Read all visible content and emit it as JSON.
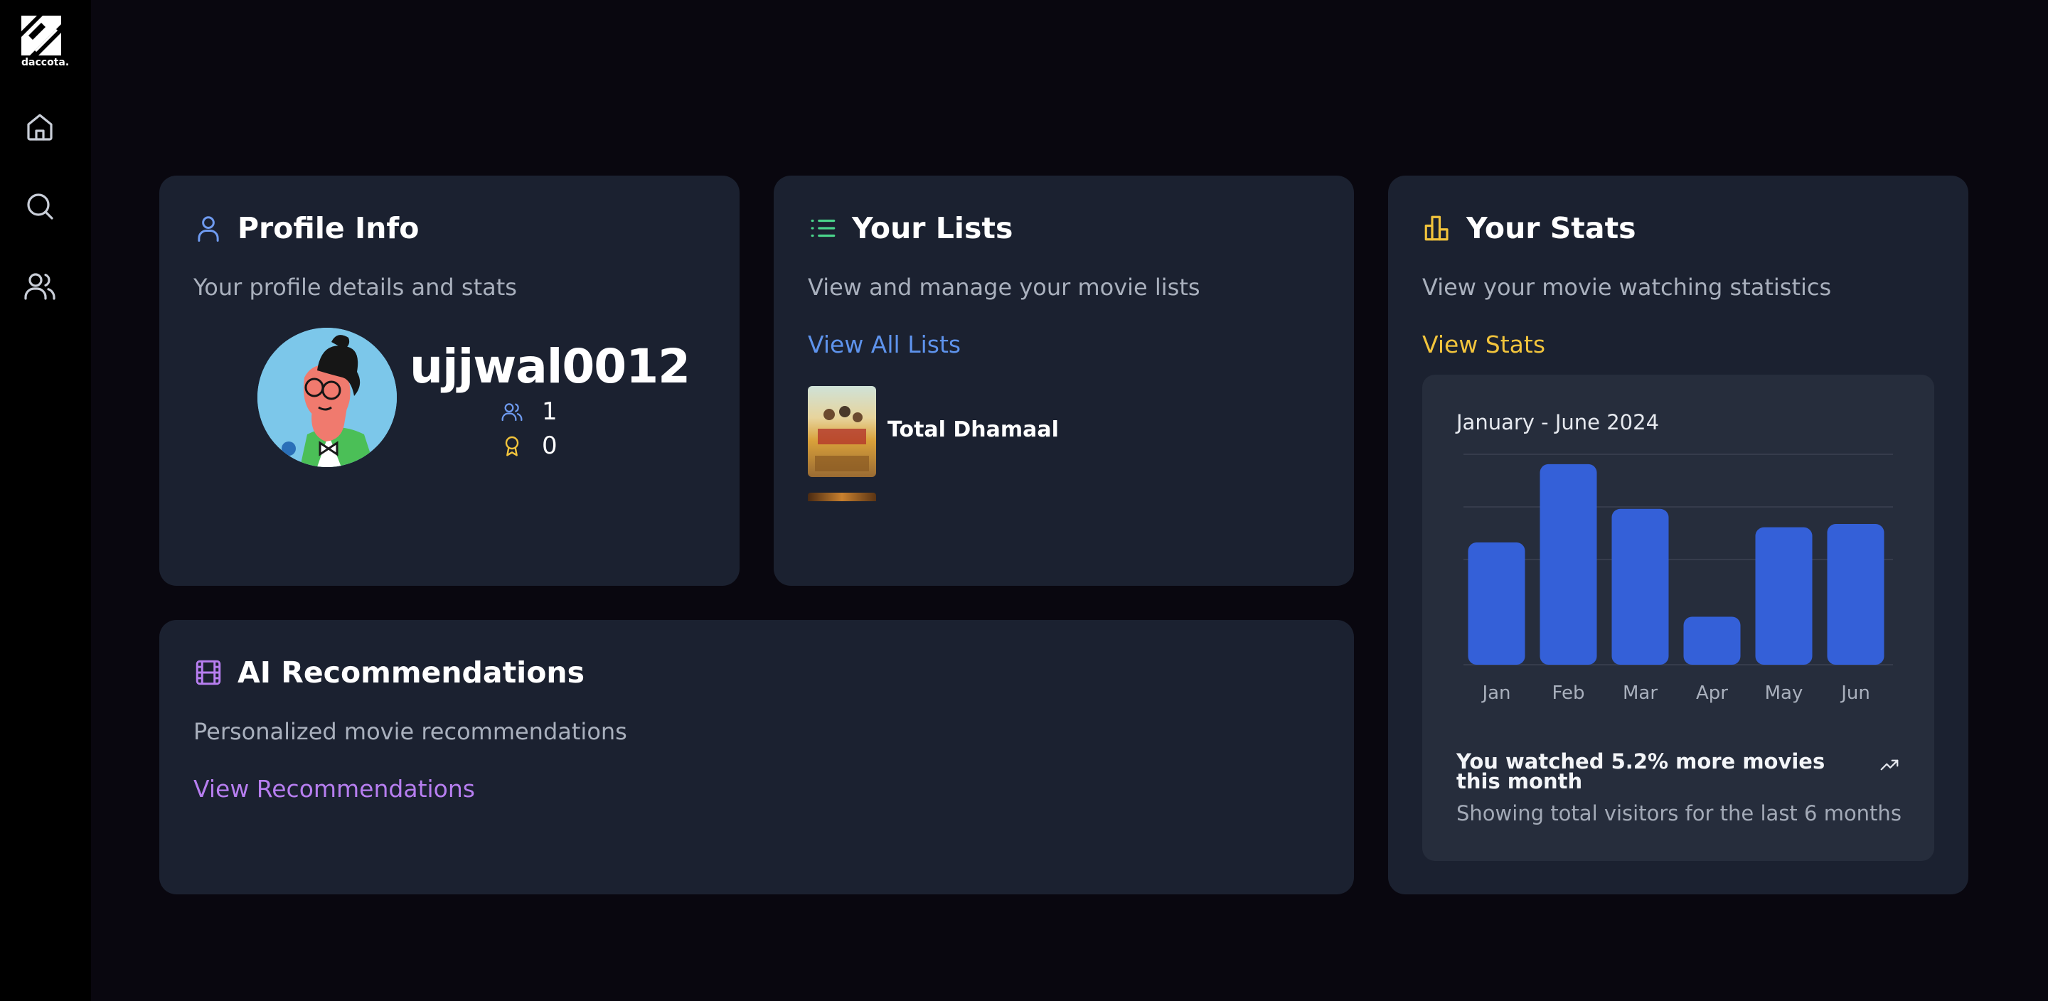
{
  "sidebar": {
    "logo_text": "daccota.",
    "nav": [
      "home-icon",
      "search-icon",
      "users-icon"
    ]
  },
  "profile": {
    "title": "Profile Info",
    "subtitle": "Your profile details and stats",
    "username": "ujjwal0012",
    "followers": "1",
    "awards": "0",
    "icon_color": "#6f9bf0"
  },
  "lists": {
    "title": "Your Lists",
    "subtitle": "View and manage your movie lists",
    "link": "View All Lists",
    "link_color": "#5e93ec",
    "items": [
      "Total Dhamaal"
    ],
    "icon_color": "#4ad48a"
  },
  "stats": {
    "title": "Your Stats",
    "subtitle": "View your movie watching statistics",
    "link": "View Stats",
    "link_color": "#f2c43c",
    "icon_color": "#f2c43c",
    "chart_range": "January - June 2024",
    "trend_title": "You watched 5.2% more movies this month",
    "trend_note": "Showing total visitors for the last 6 months"
  },
  "ai": {
    "title": "AI Recommendations",
    "subtitle": "Personalized movie recommendations",
    "link": "View Recommendations",
    "link_color": "#b77ef0",
    "icon_color": "#b77ef0"
  },
  "chart_data": {
    "type": "bar",
    "categories": [
      "Jan",
      "Feb",
      "Mar",
      "Apr",
      "May",
      "Jun"
    ],
    "values": [
      186,
      305,
      237,
      73,
      209,
      214
    ],
    "ylim": [
      0,
      320
    ],
    "grid": true,
    "bar_color": "#3460d8"
  }
}
